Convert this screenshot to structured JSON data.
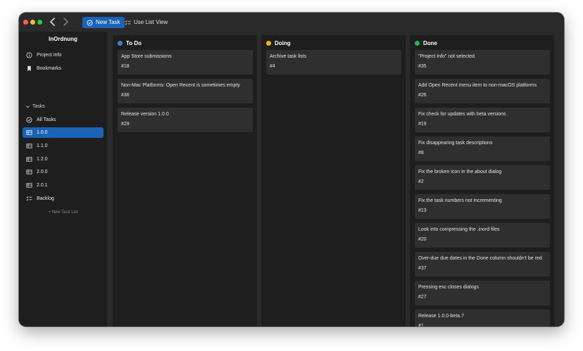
{
  "toolbar": {
    "new_task_label": "New Task",
    "list_view_label": "Use List View"
  },
  "sidebar": {
    "app_title": "InOrdnung",
    "top_items": [
      {
        "label": "Project Info",
        "icon": "info-circle-icon"
      },
      {
        "label": "Bookmarks",
        "icon": "bookmark-icon"
      }
    ],
    "tasks_section_label": "Tasks",
    "task_items": [
      {
        "label": "All Tasks",
        "icon": "checkmark-circle-icon"
      },
      {
        "label": "1.0.0",
        "icon": "task-list-icon",
        "active": true
      },
      {
        "label": "1.1.0",
        "icon": "task-list-icon"
      },
      {
        "label": "1.2.0",
        "icon": "task-list-icon"
      },
      {
        "label": "2.0.0",
        "icon": "task-list-icon"
      },
      {
        "label": "2.0.1",
        "icon": "task-list-icon"
      },
      {
        "label": "Backlog",
        "icon": "checklist-icon"
      }
    ],
    "new_list_label": "+ New Task List"
  },
  "colors": {
    "accent": "#1a63b6",
    "todo": "#3b82c4",
    "doing": "#f4b400",
    "done": "#2fb34a"
  },
  "columns": [
    {
      "title": "To Do",
      "color": "#3b82c4",
      "cards": [
        {
          "title": "App Store submissions",
          "number": "#18"
        },
        {
          "title": "Non-Mac Platforms: Open Recent is sometimes empty",
          "number": "#36"
        },
        {
          "title": "Release version 1.0.0",
          "number": "#29"
        }
      ]
    },
    {
      "title": "Doing",
      "color": "#f4b400",
      "cards": [
        {
          "title": "Archive task lists",
          "number": "#4"
        }
      ]
    },
    {
      "title": "Done",
      "color": "#2fb34a",
      "cards": [
        {
          "title": "\"Project Info\" not selected",
          "number": "#35"
        },
        {
          "title": "Add Open Recent menu item to non-macOS platforms",
          "number": "#26"
        },
        {
          "title": "Fix check for updates with beta versions",
          "number": "#19"
        },
        {
          "title": "Fix disappearing task descriptions",
          "number": "#8"
        },
        {
          "title": "Fix the broken icon in the about dialog",
          "number": "#2"
        },
        {
          "title": "Fix the task numbers not incrementing",
          "number": "#13"
        },
        {
          "title": "Look into compressing the .inord files",
          "number": "#20"
        },
        {
          "title": "Over-due due dates in the Done column shouldn't be red",
          "number": "#37"
        },
        {
          "title": "Pressing esc closes dialogs",
          "number": "#27"
        },
        {
          "title": "Release 1.0.0-beta.7",
          "number": "#1"
        }
      ]
    }
  ]
}
